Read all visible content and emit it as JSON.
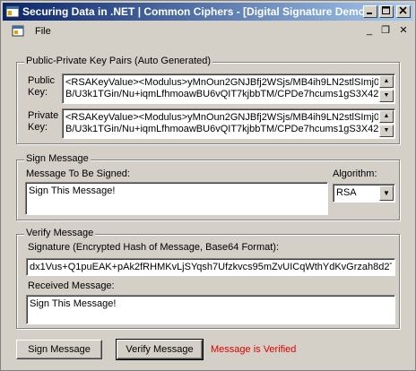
{
  "window": {
    "title": "Securing Data in .NET  |  Common Ciphers - [Digital Signature Demo]",
    "minimize_icon": "minimize-icon",
    "maximize_icon": "maximize-icon",
    "close_icon": "close-icon"
  },
  "menu": {
    "file_label": "File",
    "mdi_minimize": "_",
    "mdi_restore": "❐",
    "mdi_close": "✕"
  },
  "key_pairs": {
    "group_title": "Public-Private Key Pairs (Auto Generated)",
    "public_label": "Public\nKey:",
    "public_value": "<RSAKeyValue><Modulus>yMnOun2GNJBfj2WSjs/MB4ih9LN2stlSImj0d\nB/U3k1TGin/Nu+iqmLfhmoawBU6vQIT7kjbbTM/CPDe7hcums1gS3X42",
    "private_label": "Private\nKey:",
    "private_value": "<RSAKeyValue><Modulus>yMnOun2GNJBfj2WSjs/MB4ih9LN2stlSImj0d\nB/U3k1TGin/Nu+iqmLfhmoawBU6vQIT7kjbbTM/CPDe7hcums1gS3X42"
  },
  "sign": {
    "group_title": "Sign Message",
    "message_label": "Message To Be Signed:",
    "message_value": "Sign This Message!",
    "algorithm_label": "Algorithm:",
    "algorithm_value": "RSA"
  },
  "verify": {
    "group_title": "Verify Message",
    "signature_label": "Signature (Encrypted Hash of Message, Base64 Format):",
    "signature_value": "dx1Vus+Q1puEAK+pAk2fRHMKvLjSYqsh7Ufzkvcs95mZvUICqWthYdKvGrzah8d2T",
    "received_label": "Received Message:",
    "received_value": "Sign This Message!"
  },
  "actions": {
    "sign_button": "Sign Message",
    "verify_button": "Verify Message",
    "status_text": "Message is Verified",
    "status_color": "#e00000"
  }
}
